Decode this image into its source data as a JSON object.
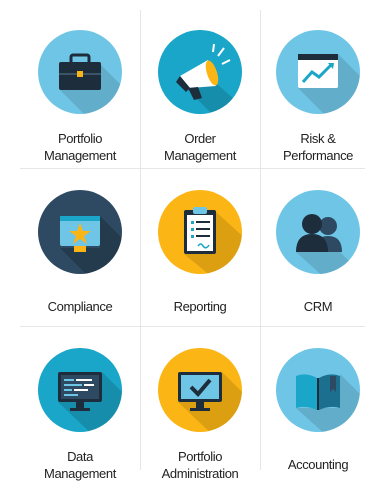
{
  "tiles": [
    {
      "label_1": "Portfolio",
      "label_2": "Management",
      "icon": "briefcase-icon"
    },
    {
      "label_1": "Order",
      "label_2": "Management",
      "icon": "megaphone-icon"
    },
    {
      "label_1": "Risk &",
      "label_2": "Performance",
      "icon": "chart-window-icon"
    },
    {
      "label_1": "Compliance",
      "label_2": "",
      "icon": "star-certificate-icon"
    },
    {
      "label_1": "Reporting",
      "label_2": "",
      "icon": "clipboard-icon"
    },
    {
      "label_1": "CRM",
      "label_2": "",
      "icon": "people-icon"
    },
    {
      "label_1": "Data",
      "label_2": "Management",
      "icon": "monitor-data-icon"
    },
    {
      "label_1": "Portfolio",
      "label_2": "Administration",
      "icon": "monitor-check-icon"
    },
    {
      "label_1": "Accounting",
      "label_2": "",
      "icon": "book-icon"
    }
  ],
  "colors": {
    "circle_light_blue": "#6fc5e6",
    "circle_teal": "#1aa6c8",
    "circle_navy": "#2e4a62",
    "circle_gold": "#fbb515",
    "shadow": "#000000"
  }
}
